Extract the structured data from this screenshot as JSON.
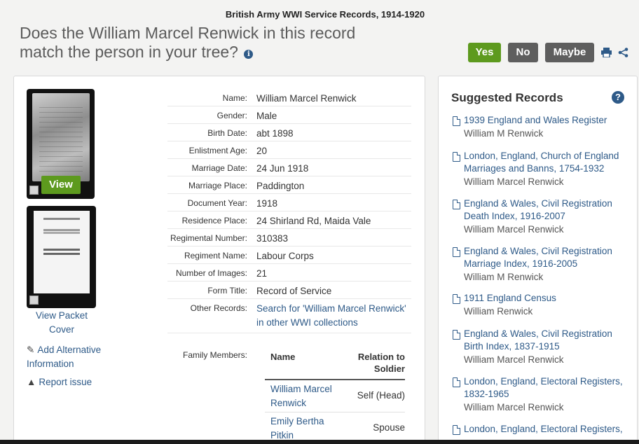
{
  "header": {
    "db_title": "British Army WWI Service Records, 1914-1920",
    "question_line1": "Does the William Marcel Renwick in this record",
    "question_line2": "match the person in your tree?",
    "info_glyph": "i",
    "yes_label": "Yes",
    "no_label": "No",
    "maybe_label": "Maybe"
  },
  "icons": {
    "print": "print-icon",
    "share": "share-icon",
    "edit": "pencil-icon",
    "warning": "warning-icon",
    "document": "document-icon"
  },
  "colors": {
    "accent_green": "#5d9a1e",
    "link_blue": "#2e5a88",
    "button_gray": "#5e5e5e"
  },
  "left": {
    "view_label": "View",
    "packet_link": "View Packet Cover",
    "add_alt_link": "Add Alternative Information",
    "report_link": "Report issue"
  },
  "details": [
    {
      "label": "Name:",
      "value": "William Marcel Renwick"
    },
    {
      "label": "Gender:",
      "value": "Male"
    },
    {
      "label": "Birth Date:",
      "value": "abt 1898"
    },
    {
      "label": "Enlistment Age:",
      "value": "20"
    },
    {
      "label": "Marriage Date:",
      "value": "24 Jun 1918"
    },
    {
      "label": "Marriage Place:",
      "value": "Paddington"
    },
    {
      "label": "Document Year:",
      "value": "1918"
    },
    {
      "label": "Residence Place:",
      "value": "24 Shirland Rd, Maida Vale"
    },
    {
      "label": "Regimental Number:",
      "value": "310383"
    },
    {
      "label": "Regiment Name:",
      "value": "Labour Corps"
    },
    {
      "label": "Number of Images:",
      "value": "21"
    },
    {
      "label": "Form Title:",
      "value": "Record of Service"
    },
    {
      "label": "Other Records:",
      "value": "Search for 'William Marcel Renwick' in other WWI collections"
    }
  ],
  "family": {
    "label": "Family Members:",
    "col_name": "Name",
    "col_relation": "Relation to Soldier",
    "rows": [
      {
        "name": "William Marcel Renwick",
        "relation": "Self (Head)"
      },
      {
        "name": "Emily Bertha Pitkin",
        "relation": "Spouse"
      }
    ]
  },
  "suggested": {
    "title": "Suggested Records",
    "help_glyph": "?",
    "items": [
      {
        "title": "1939 England and Wales Register",
        "name": "William M Renwick"
      },
      {
        "title": "London, England, Church of England Marriages and Banns, 1754-1932",
        "name": "William Marcel Renwick"
      },
      {
        "title": "England & Wales, Civil Registration Death Index, 1916-2007",
        "name": "William Marcel Renwick"
      },
      {
        "title": "England & Wales, Civil Registration Marriage Index, 1916-2005",
        "name": "William M Renwick"
      },
      {
        "title": "1911 England Census",
        "name": "William Renwick"
      },
      {
        "title": "England & Wales, Civil Registration Birth Index, 1837-1915",
        "name": "William Marcel Renwick"
      },
      {
        "title": "London, England, Electoral Registers, 1832-1965",
        "name": "William Marcel Renwick"
      },
      {
        "title": "London, England, Electoral Registers,",
        "name": ""
      }
    ]
  }
}
